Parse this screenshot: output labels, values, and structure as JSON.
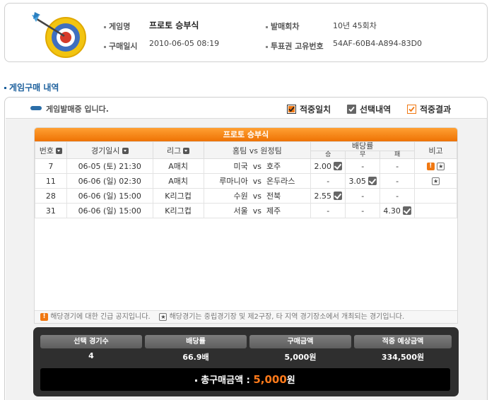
{
  "info": {
    "game_name_label": "게임명",
    "game_name": "프로토 승부식",
    "round_label": "발매회차",
    "round": "10년 45회차",
    "purchase_time_label": "구매일시",
    "purchase_time": "2010-06-05 08:19",
    "ticket_id_label": "투표권 고유번호",
    "ticket_id": "54AF-60B4-A894-83D0"
  },
  "section_title": "게임구매 내역",
  "status_text": "게임발매중 입니다.",
  "legend": {
    "hit": "적중일치",
    "selected": "선택내역",
    "result": "적중결과"
  },
  "game_table": {
    "title": "프로토 승부식",
    "headers": {
      "no": "번호",
      "datetime": "경기일시",
      "league": "리그",
      "match": "홈팀 vs 원정팀",
      "odds": "배당률",
      "win": "승",
      "draw": "무",
      "lose": "패",
      "note": "비고"
    },
    "rows": [
      {
        "no": "7",
        "datetime": "06-05 (토) 21:30",
        "league": "A매치",
        "home": "미국",
        "vs": "vs",
        "away": "호주",
        "win": "2.00",
        "draw": "-",
        "lose": "-",
        "pick": "win",
        "alert": true,
        "star": true
      },
      {
        "no": "11",
        "datetime": "06-06 (일) 02:30",
        "league": "A매치",
        "home": "루마니아",
        "vs": "vs",
        "away": "온두라스",
        "win": "-",
        "draw": "3.05",
        "lose": "-",
        "pick": "draw",
        "alert": false,
        "star": true
      },
      {
        "no": "28",
        "datetime": "06-06 (일) 15:00",
        "league": "K리그컵",
        "home": "수원",
        "vs": "vs",
        "away": "전북",
        "win": "2.55",
        "draw": "-",
        "lose": "-",
        "pick": "win",
        "alert": false,
        "star": false
      },
      {
        "no": "31",
        "datetime": "06-06 (일) 15:00",
        "league": "K리그컵",
        "home": "서울",
        "vs": "vs",
        "away": "제주",
        "win": "-",
        "draw": "-",
        "lose": "4.30",
        "pick": "lose",
        "alert": false,
        "star": false
      }
    ],
    "notice_alert": "해당경기에 대한 긴급 공지입니다.",
    "notice_star": "해당경기는 중립경기장 및 제2구장, 타 지역 경기장소에서 개최되는 경기입니다."
  },
  "summary": {
    "selected_games_label": "선택 경기수",
    "selected_games": "4",
    "odds_label": "배당률",
    "odds": "66.9배",
    "purchase_amount_label": "구매금액",
    "purchase_amount": "5,000원",
    "expected_label": "적중 예상금액",
    "expected": "334,500원",
    "total_label": "총구매금액 :",
    "total_value": "5,000",
    "total_unit": "원"
  },
  "colors": {
    "accent_orange": "#ee7203",
    "title_blue": "#1b5f9c"
  }
}
